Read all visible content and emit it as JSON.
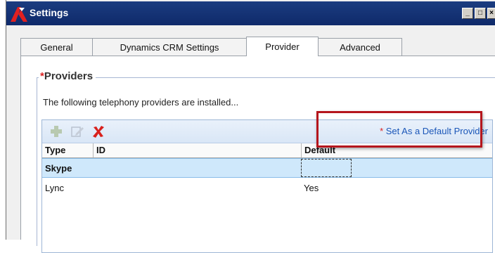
{
  "window": {
    "title": "Settings",
    "controls": {
      "minimize": "_",
      "maximize": "□",
      "close": "×"
    },
    "title_bar_color": "#1b3c80"
  },
  "tabs": [
    {
      "label": "General",
      "active": false
    },
    {
      "label": "Dynamics CRM Settings",
      "active": false
    },
    {
      "label": "Provider",
      "active": true
    },
    {
      "label": "Advanced",
      "active": false
    }
  ],
  "providers_group": {
    "required_marker": "*",
    "title": "Providers",
    "description": "The following telephony providers are installed..."
  },
  "toolbar": {
    "add_icon": "add-icon",
    "edit_icon": "edit-icon",
    "delete_icon": "delete-icon",
    "default_link_marker": "*",
    "default_link_label": "Set As a Default Provider"
  },
  "grid": {
    "columns": [
      "Type",
      "ID",
      "Default"
    ],
    "rows": [
      {
        "type": "Skype",
        "id": "",
        "default": "",
        "selected": true
      },
      {
        "type": "Lync",
        "id": "",
        "default": "Yes",
        "selected": false
      }
    ]
  },
  "annotation": {
    "color": "#b5161d"
  }
}
